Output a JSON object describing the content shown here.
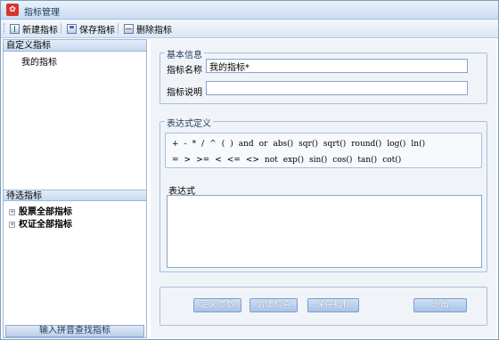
{
  "window": {
    "title": "指标管理",
    "app_icon": "app-logo-icon"
  },
  "toolbar": {
    "new_label": "新建指标",
    "save_label": "保存指标",
    "delete_label": "删除指标"
  },
  "left": {
    "custom_header": "自定义指标",
    "custom_items": [
      "我的指标"
    ],
    "candidate_header": "待选指标",
    "candidate_items": [
      "股票全部指标",
      "权证全部指标"
    ],
    "search_button": "输入拼音查找指标"
  },
  "basic": {
    "legend": "基本信息",
    "name_label": "指标名称",
    "name_value": "我的指标*",
    "desc_label": "指标说明",
    "desc_value": ""
  },
  "expression": {
    "legend": "表达式定义",
    "row1": [
      "+",
      "-",
      "*",
      "/",
      "^",
      "(",
      ")",
      "and",
      "or",
      "abs()",
      "sqr()",
      "sqrt()",
      "round()",
      "log()",
      "ln()"
    ],
    "row2": [
      "=",
      ">",
      ">=",
      "<",
      "<=",
      "<>",
      "not",
      "exp()",
      "sin()",
      "cos()",
      "tan()",
      "cot()"
    ],
    "expr_label": "表达式",
    "expr_value": ""
  },
  "buttons": {
    "define_params": "定义参数",
    "syntax_check": "语法检查",
    "save": "保存指标",
    "exit": "退出"
  }
}
